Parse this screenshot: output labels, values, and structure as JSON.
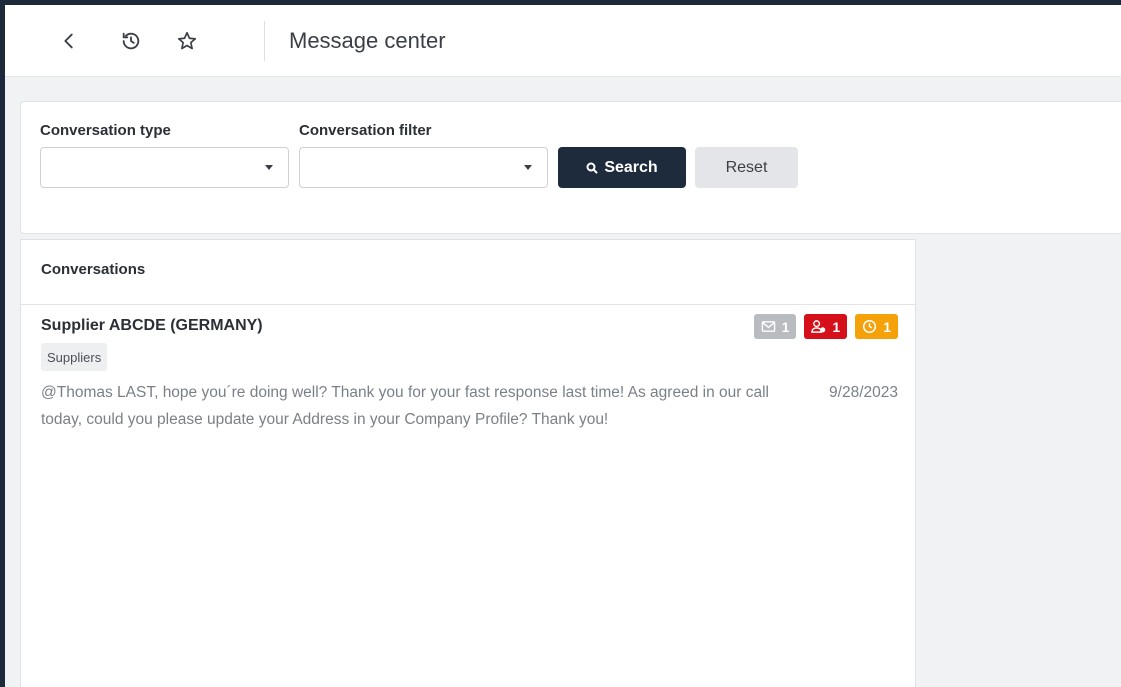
{
  "header": {
    "title": "Message center",
    "icons": [
      "back-icon",
      "history-icon",
      "star-icon"
    ]
  },
  "filters": {
    "conversation_type": {
      "label": "Conversation type",
      "value": ""
    },
    "conversation_filter": {
      "label": "Conversation filter",
      "value": ""
    },
    "search_label": "Search",
    "reset_label": "Reset"
  },
  "conversations": {
    "title": "Conversations",
    "items": [
      {
        "name": "Supplier ABCDE (GERMANY)",
        "tag": "Suppliers",
        "message": "@Thomas LAST, hope you´re doing well? Thank you for your fast response last time! As agreed in our call today, could you please update your Address in your Company Profile? Thank you!",
        "date": "9/28/2023",
        "badges": {
          "messages": "1",
          "users": "1",
          "pending": "1"
        }
      }
    ]
  },
  "colors": {
    "nav_dark": "#1e2b3d",
    "badge_gray": "#b8bbbf",
    "badge_red": "#d6101a",
    "badge_orange": "#f4a10a"
  }
}
